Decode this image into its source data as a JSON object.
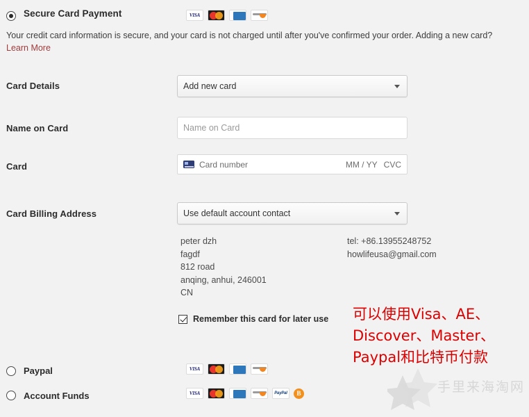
{
  "page": {
    "background_color": "#f2f2f2",
    "link_color": "#a03c3c",
    "annotation_color": "#dd0000"
  },
  "secure_section": {
    "title": "Secure Card Payment",
    "selected": true,
    "description": "Your credit card information is secure, and your card is not charged until after you've confirmed your order. Adding a new card?",
    "learn_more_label": "Learn More",
    "brand_icons": [
      "visa-icon",
      "mastercard-icon",
      "amex-icon",
      "discover-icon"
    ]
  },
  "fields": {
    "card_details": {
      "label": "Card Details",
      "value": "Add new card",
      "options": [
        "Add new card"
      ]
    },
    "name_on_card": {
      "label": "Name on Card",
      "value": "",
      "placeholder": "Name on Card"
    },
    "card": {
      "label": "Card",
      "number_placeholder": "Card number",
      "expiry_placeholder": "MM / YY",
      "cvc_placeholder": "CVC",
      "icon": "credit-card-icon"
    },
    "billing_address": {
      "label": "Card Billing Address",
      "value": "Use default account contact",
      "options": [
        "Use default account contact"
      ]
    }
  },
  "address": {
    "name": "peter dzh",
    "line1": "fagdf",
    "line2": "812 road",
    "city_state_zip": "anqing, anhui, 246001",
    "country": "CN",
    "left_block": "peter dzh\nfagdf\n812 road\nanqing, anhui, 246001\nCN",
    "tel": "tel: +86.13955248752",
    "email": "howlifeusa@gmail.com",
    "right_block": "tel: +86.13955248752\nhowlifeusa@gmail.com"
  },
  "remember_card": {
    "label": "Remember this card for later use",
    "checked": true
  },
  "annotation": {
    "text": "可以使用Visa、AE、Discover、Master、Paypal和比特币付款"
  },
  "payment_options": [
    {
      "label": "Paypal",
      "selected": false,
      "brand_icons": [
        "visa-icon",
        "mastercard-icon",
        "amex-icon",
        "discover-icon"
      ]
    },
    {
      "label": "Account Funds",
      "selected": false,
      "brand_icons": [
        "visa-icon",
        "mastercard-icon",
        "amex-icon",
        "discover-icon",
        "paypal-icon",
        "bitcoin-icon"
      ]
    }
  ],
  "brand_labels": {
    "visa": "VISA",
    "paypal": "PayPal",
    "bitcoin": "B"
  },
  "watermark": {
    "text": "手里来海淘网"
  }
}
